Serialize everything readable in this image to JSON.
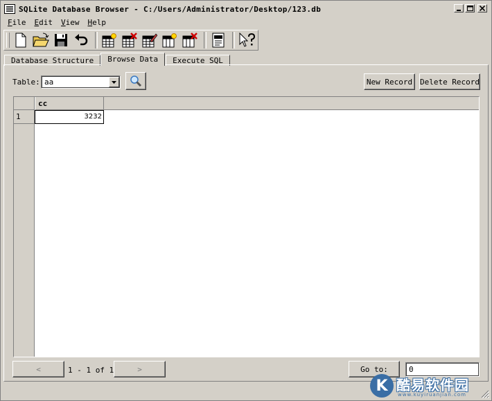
{
  "window": {
    "title": "SQLite Database Browser - C:/Users/Administrator/Desktop/123.db"
  },
  "menu": [
    {
      "accel": "F",
      "rest": "ile"
    },
    {
      "accel": "E",
      "rest": "dit"
    },
    {
      "accel": "V",
      "rest": "iew"
    },
    {
      "accel": "H",
      "rest": "elp"
    }
  ],
  "toolbar": {
    "icons": [
      "new-database-icon",
      "open-database-icon",
      "save-icon",
      "undo-icon",
      "create-table-icon",
      "delete-table-icon",
      "modify-table-icon",
      "create-index-icon",
      "delete-index-icon",
      "log-icon",
      "whats-this-icon"
    ]
  },
  "tabs": [
    {
      "label": "Database Structure",
      "active": false
    },
    {
      "label": "Browse Data",
      "active": true
    },
    {
      "label": "Execute SQL",
      "active": false
    }
  ],
  "browse": {
    "table_label": "Table:",
    "table_value": "aa",
    "new_record": "New Record",
    "delete_record": "Delete Record",
    "columns": [
      "cc"
    ],
    "rows": [
      {
        "row_num": "1",
        "cells": [
          "3232"
        ]
      }
    ],
    "prev_label": "<",
    "next_label": ">",
    "record_info": "1 - 1 of 1",
    "goto_label": "Go to:",
    "goto_value": "0"
  },
  "watermark": {
    "letter": "K",
    "text": "酷易软件园",
    "url": "www.kuyiruanjian.com"
  },
  "colors": {
    "face": "#d4d0c8",
    "shadow": "#808080",
    "highlight": "#ffffff",
    "watermark": "#3a6ea5"
  }
}
